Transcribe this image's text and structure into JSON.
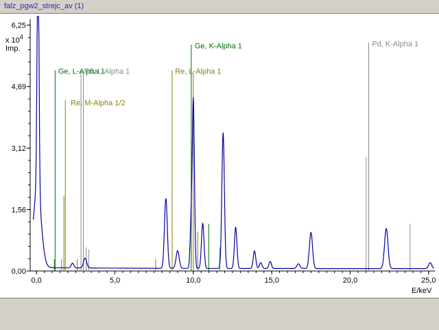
{
  "window": {
    "title": "falz_pgw2_strejc_av (1)"
  },
  "chart_data": {
    "type": "line",
    "title": "",
    "xlabel": "E/keV",
    "ylabel": "Imp.",
    "y_multiplier_base": "x 10",
    "y_multiplier_exp": "4",
    "xlim": [
      -0.4,
      25.4
    ],
    "ylim": [
      0,
      6.4
    ],
    "x_ticks": [
      0,
      5,
      10,
      15,
      20,
      25
    ],
    "x_tick_labels": [
      "0,0",
      "5,0",
      "10,0",
      "15,0",
      "20,0",
      "25,0"
    ],
    "y_ticks": [
      0,
      1.56,
      3.12,
      4.69,
      6.25
    ],
    "y_tick_labels": [
      "0,00",
      "1,56",
      "3,12",
      "4,69",
      "6,25"
    ],
    "grid": false,
    "spectrum": {
      "color": "#0000a0",
      "baseline": 0.06,
      "peaks": [
        {
          "e": 0.1,
          "h": 6.5,
          "w": 0.06
        },
        {
          "e": 0.05,
          "h": 2.0,
          "w": 0.25
        },
        {
          "e": 2.3,
          "h": 0.12,
          "w": 0.08
        },
        {
          "e": 3.1,
          "h": 0.25,
          "w": 0.1
        },
        {
          "e": 8.25,
          "h": 1.78,
          "w": 0.09
        },
        {
          "e": 9.0,
          "h": 0.45,
          "w": 0.1
        },
        {
          "e": 9.85,
          "h": 1.0,
          "w": 0.06
        },
        {
          "e": 10.0,
          "h": 4.3,
          "w": 0.07
        },
        {
          "e": 10.6,
          "h": 1.15,
          "w": 0.08
        },
        {
          "e": 11.9,
          "h": 3.45,
          "w": 0.08
        },
        {
          "e": 12.7,
          "h": 1.05,
          "w": 0.08
        },
        {
          "e": 13.9,
          "h": 0.45,
          "w": 0.08
        },
        {
          "e": 14.3,
          "h": 0.15,
          "w": 0.08
        },
        {
          "e": 14.9,
          "h": 0.18,
          "w": 0.08
        },
        {
          "e": 16.7,
          "h": 0.12,
          "w": 0.1
        },
        {
          "e": 17.5,
          "h": 0.92,
          "w": 0.1
        },
        {
          "e": 22.3,
          "h": 1.02,
          "w": 0.11
        },
        {
          "e": 25.1,
          "h": 0.15,
          "w": 0.1
        }
      ]
    },
    "element_lines": [
      {
        "element": "Ge",
        "family": "L",
        "color": "#007000",
        "lines": [
          {
            "e": 1.19,
            "h": 5.1
          },
          {
            "e": 1.14,
            "h": 0.3
          }
        ]
      },
      {
        "element": "Ge",
        "family": "K",
        "color": "#007000",
        "lines": [
          {
            "e": 9.87,
            "h": 5.75
          },
          {
            "e": 10.98,
            "h": 1.2
          }
        ]
      },
      {
        "element": "Re",
        "family": "M",
        "color": "#8a8000",
        "lines": [
          {
            "e": 1.84,
            "h": 4.35
          },
          {
            "e": 1.75,
            "h": 1.9
          },
          {
            "e": 1.6,
            "h": 0.3
          }
        ]
      },
      {
        "element": "Re",
        "family": "L",
        "color": "#8a8000",
        "lines": [
          {
            "e": 8.65,
            "h": 5.1
          },
          {
            "e": 10.0,
            "h": 5.05
          },
          {
            "e": 10.28,
            "h": 1.0
          },
          {
            "e": 11.68,
            "h": 0.6
          },
          {
            "e": 7.6,
            "h": 0.3
          },
          {
            "e": 2.6,
            "h": 0.3
          }
        ]
      },
      {
        "element": "Pd",
        "family": "L",
        "color": "#888888",
        "lines": [
          {
            "e": 2.84,
            "h": 5.1
          },
          {
            "e": 2.99,
            "h": 5.05
          },
          {
            "e": 3.17,
            "h": 0.6
          },
          {
            "e": 3.33,
            "h": 0.55
          }
        ]
      },
      {
        "element": "Pd",
        "family": "K",
        "color": "#888888",
        "lines": [
          {
            "e": 21.18,
            "h": 5.8
          },
          {
            "e": 21.02,
            "h": 2.9
          },
          {
            "e": 23.82,
            "h": 1.2
          }
        ]
      }
    ],
    "annotations": [
      {
        "text": "Ge, L-Alpha 1",
        "e": 1.3,
        "y": 5.1,
        "color": "#007000"
      },
      {
        "text": "Pd, L-Alpha 1",
        "e": 2.95,
        "y": 5.1,
        "color": "#888888"
      },
      {
        "text": "Re, M-Alpha 1/2",
        "e": 2.1,
        "y": 4.3,
        "color": "#8a8000"
      },
      {
        "text": "Ge, K-Alpha 1",
        "e": 10.0,
        "y": 5.75,
        "color": "#007000"
      },
      {
        "text": "Re, L-Alpha 1",
        "e": 8.75,
        "y": 5.1,
        "color": "#8a8000"
      },
      {
        "text": "Pd, K-Alpha 1",
        "e": 21.3,
        "y": 5.8,
        "color": "#888888"
      }
    ]
  }
}
